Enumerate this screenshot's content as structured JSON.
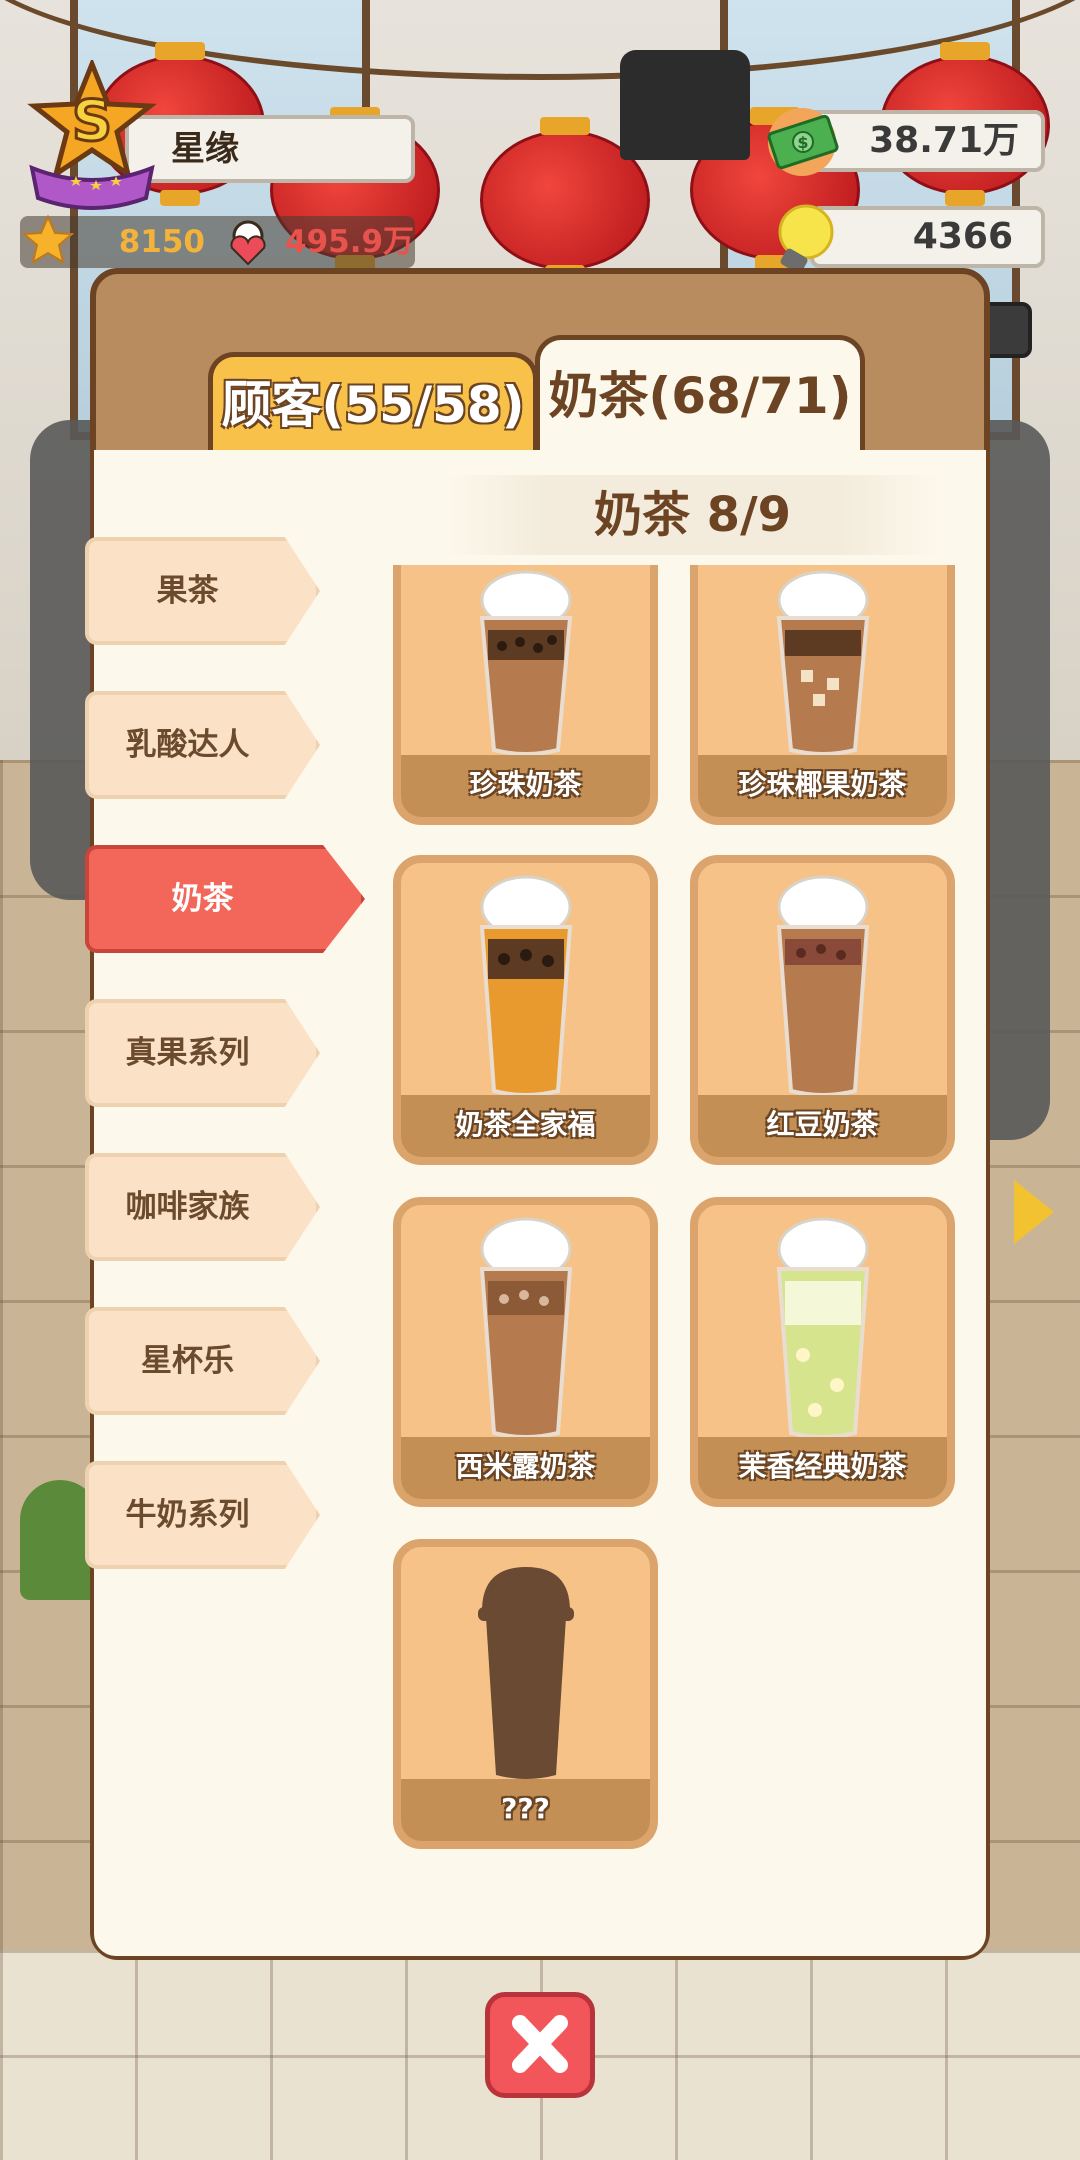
{
  "player": {
    "name": "星缘",
    "rank": "S",
    "stars": "8150",
    "fans": "495.9万"
  },
  "resources": {
    "money": "38.71万",
    "ideas": "4366"
  },
  "modal": {
    "tabs": [
      {
        "label": "顾客(55/58)",
        "active": false
      },
      {
        "label": "奶茶(68/71)",
        "active": true
      }
    ],
    "section_title": "奶茶  8/9",
    "categories": [
      {
        "label": "果茶",
        "active": false
      },
      {
        "label": "乳酸达人",
        "active": false
      },
      {
        "label": "奶茶",
        "active": true
      },
      {
        "label": "真果系列",
        "active": false
      },
      {
        "label": "咖啡家族",
        "active": false
      },
      {
        "label": "星杯乐",
        "active": false
      },
      {
        "label": "牛奶系列",
        "active": false
      }
    ],
    "drinks": [
      {
        "name": "珍珠奶茶",
        "unlocked": true
      },
      {
        "name": "珍珠椰果奶茶",
        "unlocked": true
      },
      {
        "name": "奶茶全家福",
        "unlocked": true
      },
      {
        "name": "红豆奶茶",
        "unlocked": true
      },
      {
        "name": "西米露奶茶",
        "unlocked": true
      },
      {
        "name": "茉香经典奶茶",
        "unlocked": true
      },
      {
        "name": "???",
        "unlocked": false
      }
    ]
  },
  "icons": {
    "rank_badge": "star-badge-icon",
    "stars": "star-icon",
    "fans": "fan-heart-icon",
    "money": "cash-icon",
    "ideas": "lightbulb-icon",
    "close": "close-icon"
  },
  "colors": {
    "modal_frame": "#b98c5f",
    "active_category": "#f2675a",
    "card": "#f6c288",
    "close_button": "#f2565a"
  }
}
